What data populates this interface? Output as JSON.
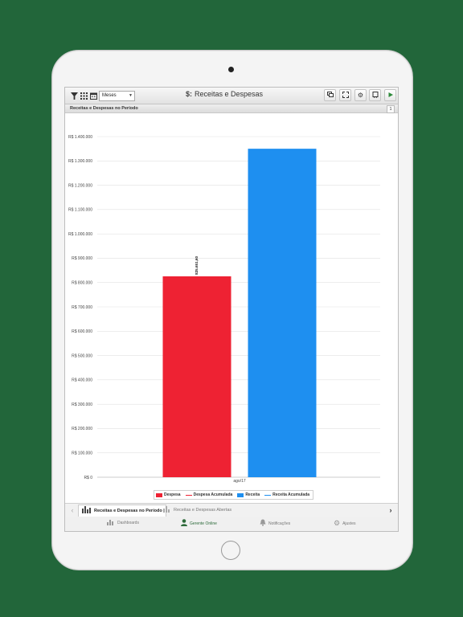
{
  "toolbar": {
    "period_select": "Meses",
    "title_icon": "$:",
    "title": "Receitas e Despesas"
  },
  "panel": {
    "header": "Receitas e Despesas no Período",
    "count": "1"
  },
  "chart_data": {
    "type": "bar",
    "categories": [
      "ago/17"
    ],
    "series": [
      {
        "name": "Despesa",
        "values": [
          825651.6
        ],
        "color": "#ee2233"
      },
      {
        "name": "Receita",
        "values": [
          1350000
        ],
        "color": "#1e8ff0"
      }
    ],
    "ylim": [
      0,
      1400000
    ],
    "yticks": [
      "R$ 0",
      "R$ 100.000",
      "R$ 200.000",
      "R$ 300.000",
      "R$ 400.000",
      "R$ 500.000",
      "R$ 600.000",
      "R$ 700.000",
      "R$ 800.000",
      "R$ 900.000",
      "R$ 1.000.000",
      "R$ 1.100.000",
      "R$ 1.200.000",
      "R$ 1.300.000",
      "R$ 1.400.000"
    ],
    "data_labels": [
      "825.651,60"
    ],
    "grid": true,
    "legend_position": "bottom"
  },
  "legend": {
    "items": [
      "Despesa",
      "Despesa Acumulada",
      "Receita",
      "Receita Acumulada"
    ],
    "colors": [
      "#ee2233",
      "#ee2233",
      "#1e8ff0",
      "#1e8ff0"
    ]
  },
  "tabs": [
    {
      "label": "Receitas e Despesas no Período"
    },
    {
      "label": "Receitas e Despesas Abertas"
    }
  ],
  "bottom_nav": [
    {
      "label": "Dashboards"
    },
    {
      "label": "Gerente Online"
    },
    {
      "label": "Notificações"
    },
    {
      "label": "Ajustes"
    }
  ],
  "colors": {
    "background": "#22663a",
    "accent": "#2d6a3a"
  }
}
